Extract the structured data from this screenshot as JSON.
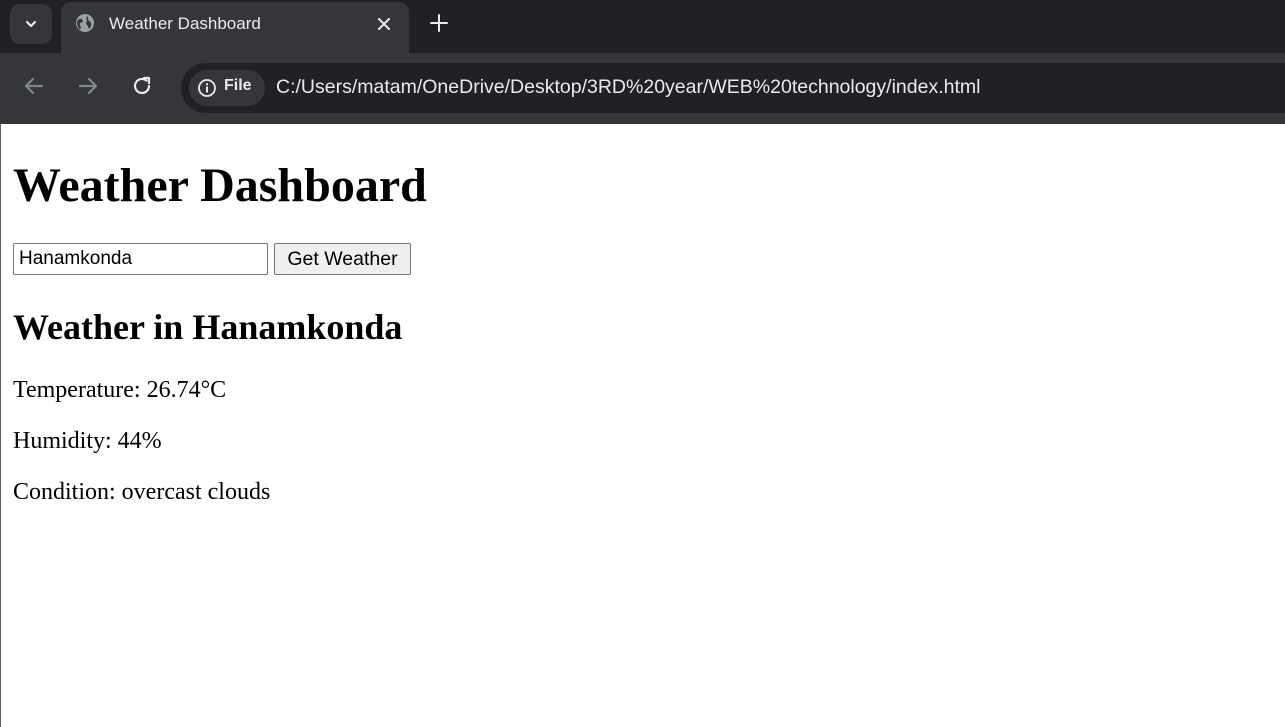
{
  "browser": {
    "tab": {
      "title": "Weather Dashboard",
      "favicon": "globe-icon"
    },
    "omnibox": {
      "chip_label": "File",
      "chip_icon": "info-icon",
      "url": "C:/Users/matam/OneDrive/Desktop/3RD%20year/WEB%20technology/index.html"
    },
    "colors": {
      "tabstrip_bg": "#202124",
      "toolbar_bg": "#35363a",
      "text": "#e8eaed"
    }
  },
  "page": {
    "heading": "Weather Dashboard",
    "search": {
      "value": "Hanamkonda",
      "button_label": "Get Weather"
    },
    "result": {
      "heading": "Weather in Hanamkonda",
      "temperature": "Temperature: 26.74°C",
      "humidity": "Humidity: 44%",
      "condition": "Condition: overcast clouds"
    }
  }
}
